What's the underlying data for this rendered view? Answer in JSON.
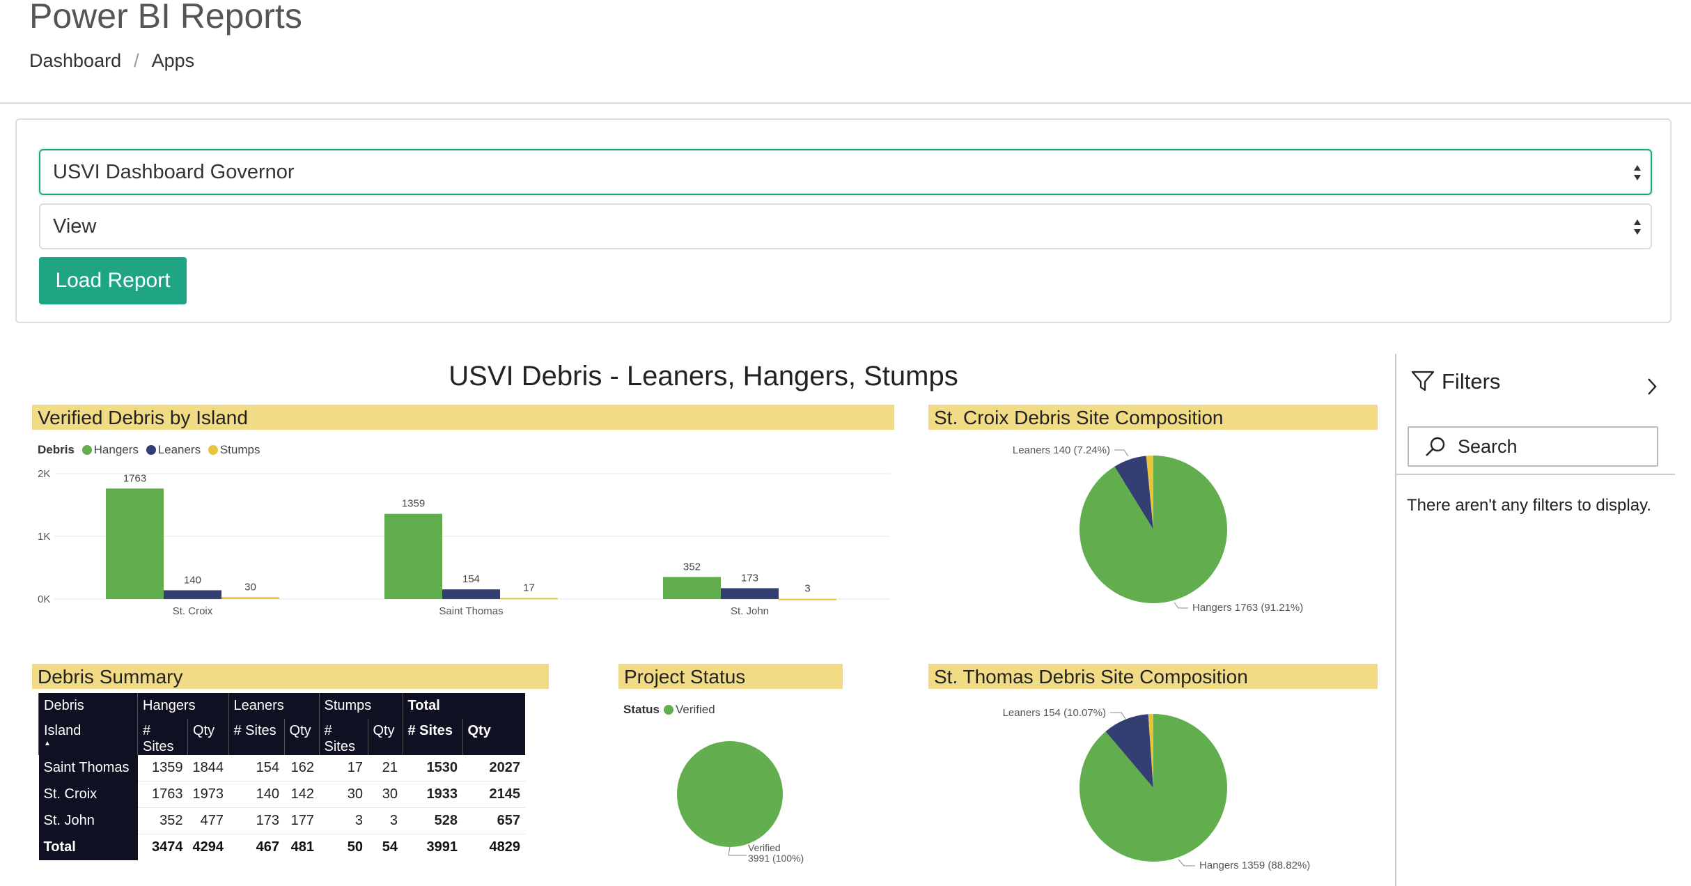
{
  "header": {
    "title": "Power BI Reports",
    "breadcrumb": [
      "Dashboard",
      "Apps"
    ],
    "separator": "/"
  },
  "form": {
    "report_select": "USVI Dashboard Governor",
    "view_select": "View",
    "load_button": "Load Report",
    "accent_color": "#1fa583"
  },
  "report": {
    "title": "USVI Debris - Leaners, Hangers, Stumps",
    "colors": {
      "hangers": "#62ad4e",
      "leaners": "#333f72",
      "stumps": "#e8c33b",
      "header_bg": "#f2db85"
    },
    "bar_visual": {
      "header": "Verified Debris by Island",
      "legend_title": "Debris",
      "legend": [
        "Hangers",
        "Leaners",
        "Stumps"
      ]
    },
    "st_croix_pie": {
      "header": "St. Croix Debris Site Composition",
      "label_leaners": "Leaners 140 (7.24%)",
      "label_hangers": "Hangers 1763 (91.21%)"
    },
    "summary_table": {
      "header": "Debris Summary",
      "group_headers": [
        "Debris",
        "Hangers",
        "Leaners",
        "Stumps",
        "Total"
      ],
      "sub_headers": [
        "Island",
        "# Sites",
        "Qty",
        "# Sites",
        "Qty",
        "# Sites",
        "Qty",
        "# Sites",
        "Qty"
      ],
      "rows": [
        [
          "Saint Thomas",
          "1359",
          "1844",
          "154",
          "162",
          "17",
          "21",
          "1530",
          "2027"
        ],
        [
          "St. Croix",
          "1763",
          "1973",
          "140",
          "142",
          "30",
          "30",
          "1933",
          "2145"
        ],
        [
          "St. John",
          "352",
          "477",
          "173",
          "177",
          "3",
          "3",
          "528",
          "657"
        ]
      ],
      "total_row": [
        "Total",
        "3474",
        "4294",
        "467",
        "481",
        "50",
        "54",
        "3991",
        "4829"
      ]
    },
    "project_status": {
      "header": "Project Status",
      "legend_title": "Status",
      "legend_item": "Verified",
      "label_line1": "Verified",
      "label_line2": "3991 (100%)"
    },
    "st_thomas_pie": {
      "header": "St. Thomas Debris Site Composition",
      "label_leaners": "Leaners 154 (10.07%)",
      "label_hangers": "Hangers 1359 (88.82%)"
    }
  },
  "filters": {
    "title": "Filters",
    "search_placeholder": "Search",
    "empty_message": "There aren't any filters to display."
  },
  "chart_data": [
    {
      "type": "bar",
      "title": "Verified Debris by Island",
      "categories": [
        "St. Croix",
        "Saint Thomas",
        "St. John"
      ],
      "series": [
        {
          "name": "Hangers",
          "values": [
            1763,
            1359,
            352
          ]
        },
        {
          "name": "Leaners",
          "values": [
            140,
            154,
            173
          ]
        },
        {
          "name": "Stumps",
          "values": [
            30,
            17,
            3
          ]
        }
      ],
      "ylim": [
        0,
        2000
      ],
      "yticks": [
        "0K",
        "1K",
        "2K"
      ],
      "legend_title": "Debris",
      "legend_position": "top-left",
      "grid": true
    },
    {
      "type": "pie",
      "title": "St. Croix Debris Site Composition",
      "labels": [
        "Hangers",
        "Leaners",
        "Stumps"
      ],
      "values": [
        1763,
        140,
        30
      ]
    },
    {
      "type": "pie",
      "title": "Project Status",
      "labels": [
        "Verified"
      ],
      "values": [
        3991
      ]
    },
    {
      "type": "pie",
      "title": "St. Thomas Debris Site Composition",
      "labels": [
        "Hangers",
        "Leaners",
        "Stumps"
      ],
      "values": [
        1359,
        154,
        17
      ]
    },
    {
      "type": "table",
      "title": "Debris Summary",
      "columns": [
        "Island",
        "Hangers # Sites",
        "Hangers Qty",
        "Leaners # Sites",
        "Leaners Qty",
        "Stumps # Sites",
        "Stumps Qty",
        "Total # Sites",
        "Total Qty"
      ],
      "rows": [
        [
          "Saint Thomas",
          1359,
          1844,
          154,
          162,
          17,
          21,
          1530,
          2027
        ],
        [
          "St. Croix",
          1763,
          1973,
          140,
          142,
          30,
          30,
          1933,
          2145
        ],
        [
          "St. John",
          352,
          477,
          173,
          177,
          3,
          3,
          528,
          657
        ],
        [
          "Total",
          3474,
          4294,
          467,
          481,
          50,
          54,
          3991,
          4829
        ]
      ]
    }
  ]
}
